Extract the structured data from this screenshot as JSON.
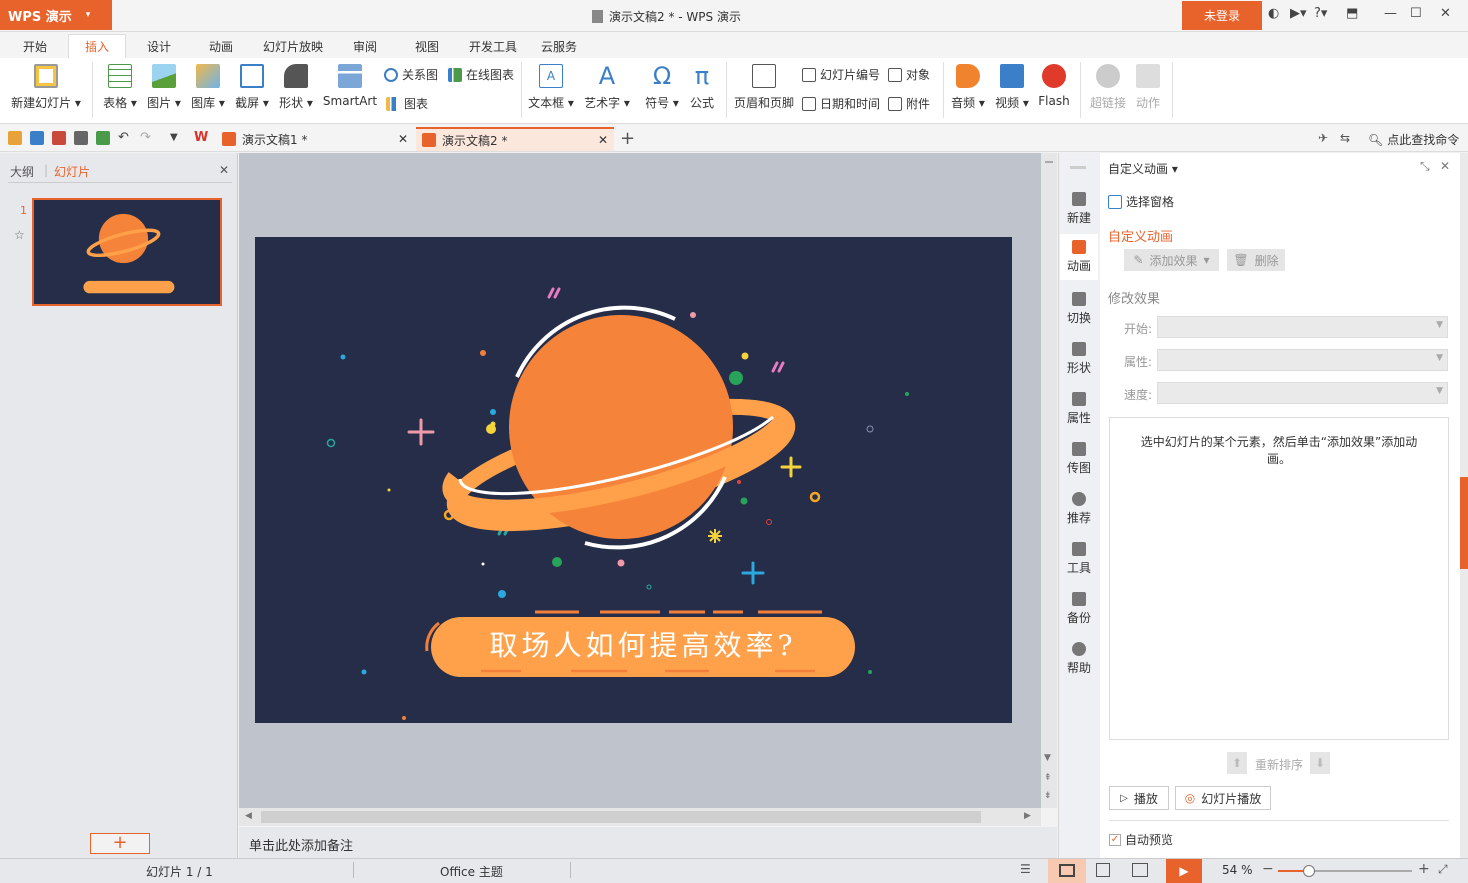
{
  "app": {
    "button": "WPS 演示",
    "title": "演示文稿2 * - WPS 演示",
    "login": "未登录",
    "help": "?"
  },
  "tabs": [
    "开始",
    "插入",
    "设计",
    "动画",
    "幻灯片放映",
    "审阅",
    "视图",
    "开发工具",
    "云服务"
  ],
  "active_tab": "插入",
  "ribbon": {
    "new_slide": "新建幻灯片",
    "table": "表格",
    "picture": "图片",
    "gallery": "图库",
    "screenshot": "截屏",
    "shape": "形状",
    "smartart": "SmartArt",
    "relation": "关系图",
    "online_chart": "在线图表",
    "chart": "图表",
    "textbox": "文本框",
    "art_text": "艺术字",
    "symbol": "符号",
    "formula": "公式",
    "header_footer": "页眉和页脚",
    "slide_number": "幻灯片编号",
    "object": "对象",
    "datetime": "日期和时间",
    "attachment": "附件",
    "audio": "音频",
    "video": "视频",
    "flash": "Flash",
    "hyperlink": "超链接",
    "action": "动作"
  },
  "doc_tabs": [
    {
      "label": "演示文稿1 *"
    },
    {
      "label": "演示文稿2 *"
    }
  ],
  "search": "点此查找命令",
  "left_pane": {
    "outline": "大纲",
    "slides": "幻灯片",
    "slide_number": "1"
  },
  "slide": {
    "caption": "取场人如何提高效率?"
  },
  "notes_placeholder": "单击此处添加备注",
  "sidebar": [
    "新建",
    "动画",
    "切换",
    "形状",
    "属性",
    "传图",
    "推荐",
    "工具",
    "备份",
    "帮助"
  ],
  "panel": {
    "header": "自定义动画",
    "select_pane": "选择窗格",
    "section_title": "自定义动画",
    "add_effect": "添加效果",
    "delete": "删除",
    "modify": "修改效果",
    "start": "开始:",
    "property": "属性:",
    "speed": "速度:",
    "hint": "选中幻灯片的某个元素，然后单击“添加效果”添加动画。",
    "reorder": "重新排序",
    "play": "播放",
    "slideshow": "幻灯片播放",
    "auto_preview": "自动预览"
  },
  "status": {
    "slide": "幻灯片 1 / 1",
    "theme": "Office 主题",
    "zoom": "54 %",
    "zoom_level": 0.54
  },
  "colors": {
    "accent": "#e8632c",
    "slide_bg": "#252d48",
    "planet": "#f5843a",
    "banner": "#ffa14a"
  }
}
